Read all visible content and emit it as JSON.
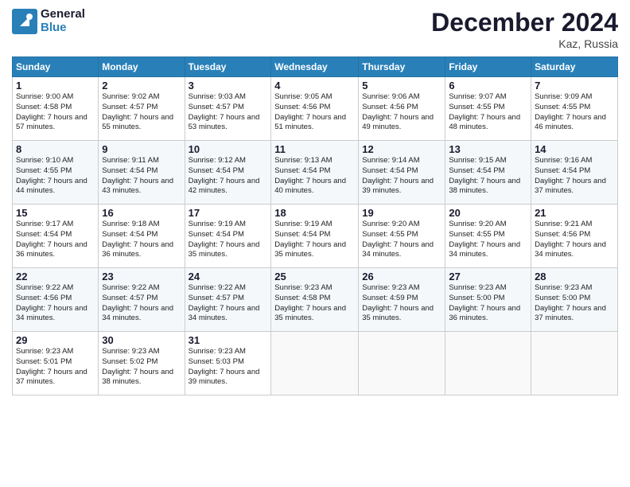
{
  "header": {
    "logo_line1": "General",
    "logo_line2": "Blue",
    "title": "December 2024",
    "subtitle": "Kaz, Russia"
  },
  "days_of_week": [
    "Sunday",
    "Monday",
    "Tuesday",
    "Wednesday",
    "Thursday",
    "Friday",
    "Saturday"
  ],
  "weeks": [
    [
      {
        "day": "1",
        "sunrise": "9:00 AM",
        "sunset": "4:58 PM",
        "daylight": "7 hours and 57 minutes."
      },
      {
        "day": "2",
        "sunrise": "9:02 AM",
        "sunset": "4:57 PM",
        "daylight": "7 hours and 55 minutes."
      },
      {
        "day": "3",
        "sunrise": "9:03 AM",
        "sunset": "4:57 PM",
        "daylight": "7 hours and 53 minutes."
      },
      {
        "day": "4",
        "sunrise": "9:05 AM",
        "sunset": "4:56 PM",
        "daylight": "7 hours and 51 minutes."
      },
      {
        "day": "5",
        "sunrise": "9:06 AM",
        "sunset": "4:56 PM",
        "daylight": "7 hours and 49 minutes."
      },
      {
        "day": "6",
        "sunrise": "9:07 AM",
        "sunset": "4:55 PM",
        "daylight": "7 hours and 48 minutes."
      },
      {
        "day": "7",
        "sunrise": "9:09 AM",
        "sunset": "4:55 PM",
        "daylight": "7 hours and 46 minutes."
      }
    ],
    [
      {
        "day": "8",
        "sunrise": "9:10 AM",
        "sunset": "4:55 PM",
        "daylight": "7 hours and 44 minutes."
      },
      {
        "day": "9",
        "sunrise": "9:11 AM",
        "sunset": "4:54 PM",
        "daylight": "7 hours and 43 minutes."
      },
      {
        "day": "10",
        "sunrise": "9:12 AM",
        "sunset": "4:54 PM",
        "daylight": "7 hours and 42 minutes."
      },
      {
        "day": "11",
        "sunrise": "9:13 AM",
        "sunset": "4:54 PM",
        "daylight": "7 hours and 40 minutes."
      },
      {
        "day": "12",
        "sunrise": "9:14 AM",
        "sunset": "4:54 PM",
        "daylight": "7 hours and 39 minutes."
      },
      {
        "day": "13",
        "sunrise": "9:15 AM",
        "sunset": "4:54 PM",
        "daylight": "7 hours and 38 minutes."
      },
      {
        "day": "14",
        "sunrise": "9:16 AM",
        "sunset": "4:54 PM",
        "daylight": "7 hours and 37 minutes."
      }
    ],
    [
      {
        "day": "15",
        "sunrise": "9:17 AM",
        "sunset": "4:54 PM",
        "daylight": "7 hours and 36 minutes."
      },
      {
        "day": "16",
        "sunrise": "9:18 AM",
        "sunset": "4:54 PM",
        "daylight": "7 hours and 36 minutes."
      },
      {
        "day": "17",
        "sunrise": "9:19 AM",
        "sunset": "4:54 PM",
        "daylight": "7 hours and 35 minutes."
      },
      {
        "day": "18",
        "sunrise": "9:19 AM",
        "sunset": "4:54 PM",
        "daylight": "7 hours and 35 minutes."
      },
      {
        "day": "19",
        "sunrise": "9:20 AM",
        "sunset": "4:55 PM",
        "daylight": "7 hours and 34 minutes."
      },
      {
        "day": "20",
        "sunrise": "9:20 AM",
        "sunset": "4:55 PM",
        "daylight": "7 hours and 34 minutes."
      },
      {
        "day": "21",
        "sunrise": "9:21 AM",
        "sunset": "4:56 PM",
        "daylight": "7 hours and 34 minutes."
      }
    ],
    [
      {
        "day": "22",
        "sunrise": "9:22 AM",
        "sunset": "4:56 PM",
        "daylight": "7 hours and 34 minutes."
      },
      {
        "day": "23",
        "sunrise": "9:22 AM",
        "sunset": "4:57 PM",
        "daylight": "7 hours and 34 minutes."
      },
      {
        "day": "24",
        "sunrise": "9:22 AM",
        "sunset": "4:57 PM",
        "daylight": "7 hours and 34 minutes."
      },
      {
        "day": "25",
        "sunrise": "9:23 AM",
        "sunset": "4:58 PM",
        "daylight": "7 hours and 35 minutes."
      },
      {
        "day": "26",
        "sunrise": "9:23 AM",
        "sunset": "4:59 PM",
        "daylight": "7 hours and 35 minutes."
      },
      {
        "day": "27",
        "sunrise": "9:23 AM",
        "sunset": "5:00 PM",
        "daylight": "7 hours and 36 minutes."
      },
      {
        "day": "28",
        "sunrise": "9:23 AM",
        "sunset": "5:00 PM",
        "daylight": "7 hours and 37 minutes."
      }
    ],
    [
      {
        "day": "29",
        "sunrise": "9:23 AM",
        "sunset": "5:01 PM",
        "daylight": "7 hours and 37 minutes."
      },
      {
        "day": "30",
        "sunrise": "9:23 AM",
        "sunset": "5:02 PM",
        "daylight": "7 hours and 38 minutes."
      },
      {
        "day": "31",
        "sunrise": "9:23 AM",
        "sunset": "5:03 PM",
        "daylight": "7 hours and 39 minutes."
      },
      null,
      null,
      null,
      null
    ]
  ],
  "labels": {
    "sunrise": "Sunrise: ",
    "sunset": "Sunset: ",
    "daylight": "Daylight: "
  }
}
